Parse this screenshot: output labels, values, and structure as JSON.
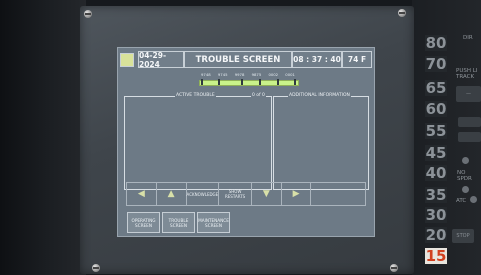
{
  "header": {
    "date": "04-29-2024",
    "title": "TROUBLE SCREEN",
    "time": "08 : 37 : 40",
    "temperature": "74 F"
  },
  "track": {
    "labels": [
      "9748",
      "9745",
      "9978",
      "9875",
      "0002",
      "0001"
    ]
  },
  "panels": {
    "active_trouble_title": "ACTIVE TROUBLE",
    "count_text": "0 of 0",
    "additional_info_title": "ADDITIONAL INFORMATION"
  },
  "softkeys": {
    "acknowledge": "ACKNOWLEDGE",
    "show_restarts": "SHOW RESTARTS"
  },
  "bottom_buttons": {
    "operating": "OPERATING SCREEN",
    "trouble": "TROUBLE SCREEN",
    "maintenance": "MAINTENANCE SCREEN"
  },
  "speed_indicator": {
    "values": [
      "80",
      "70",
      "65",
      "60",
      "55",
      "45",
      "40",
      "35",
      "30",
      "20",
      "15"
    ],
    "active_value": "15"
  },
  "side_panel": {
    "dir_label": "DIR",
    "push_track_label": "PUSH LI TRACK",
    "no_spdr_label": "NO SPDR",
    "atc_label": "ATC",
    "stop_label": "STOP"
  },
  "colors": {
    "screen_background": "#6d7a86",
    "track_line": "#c9f28a",
    "speed_active_text": "#d2401f"
  }
}
